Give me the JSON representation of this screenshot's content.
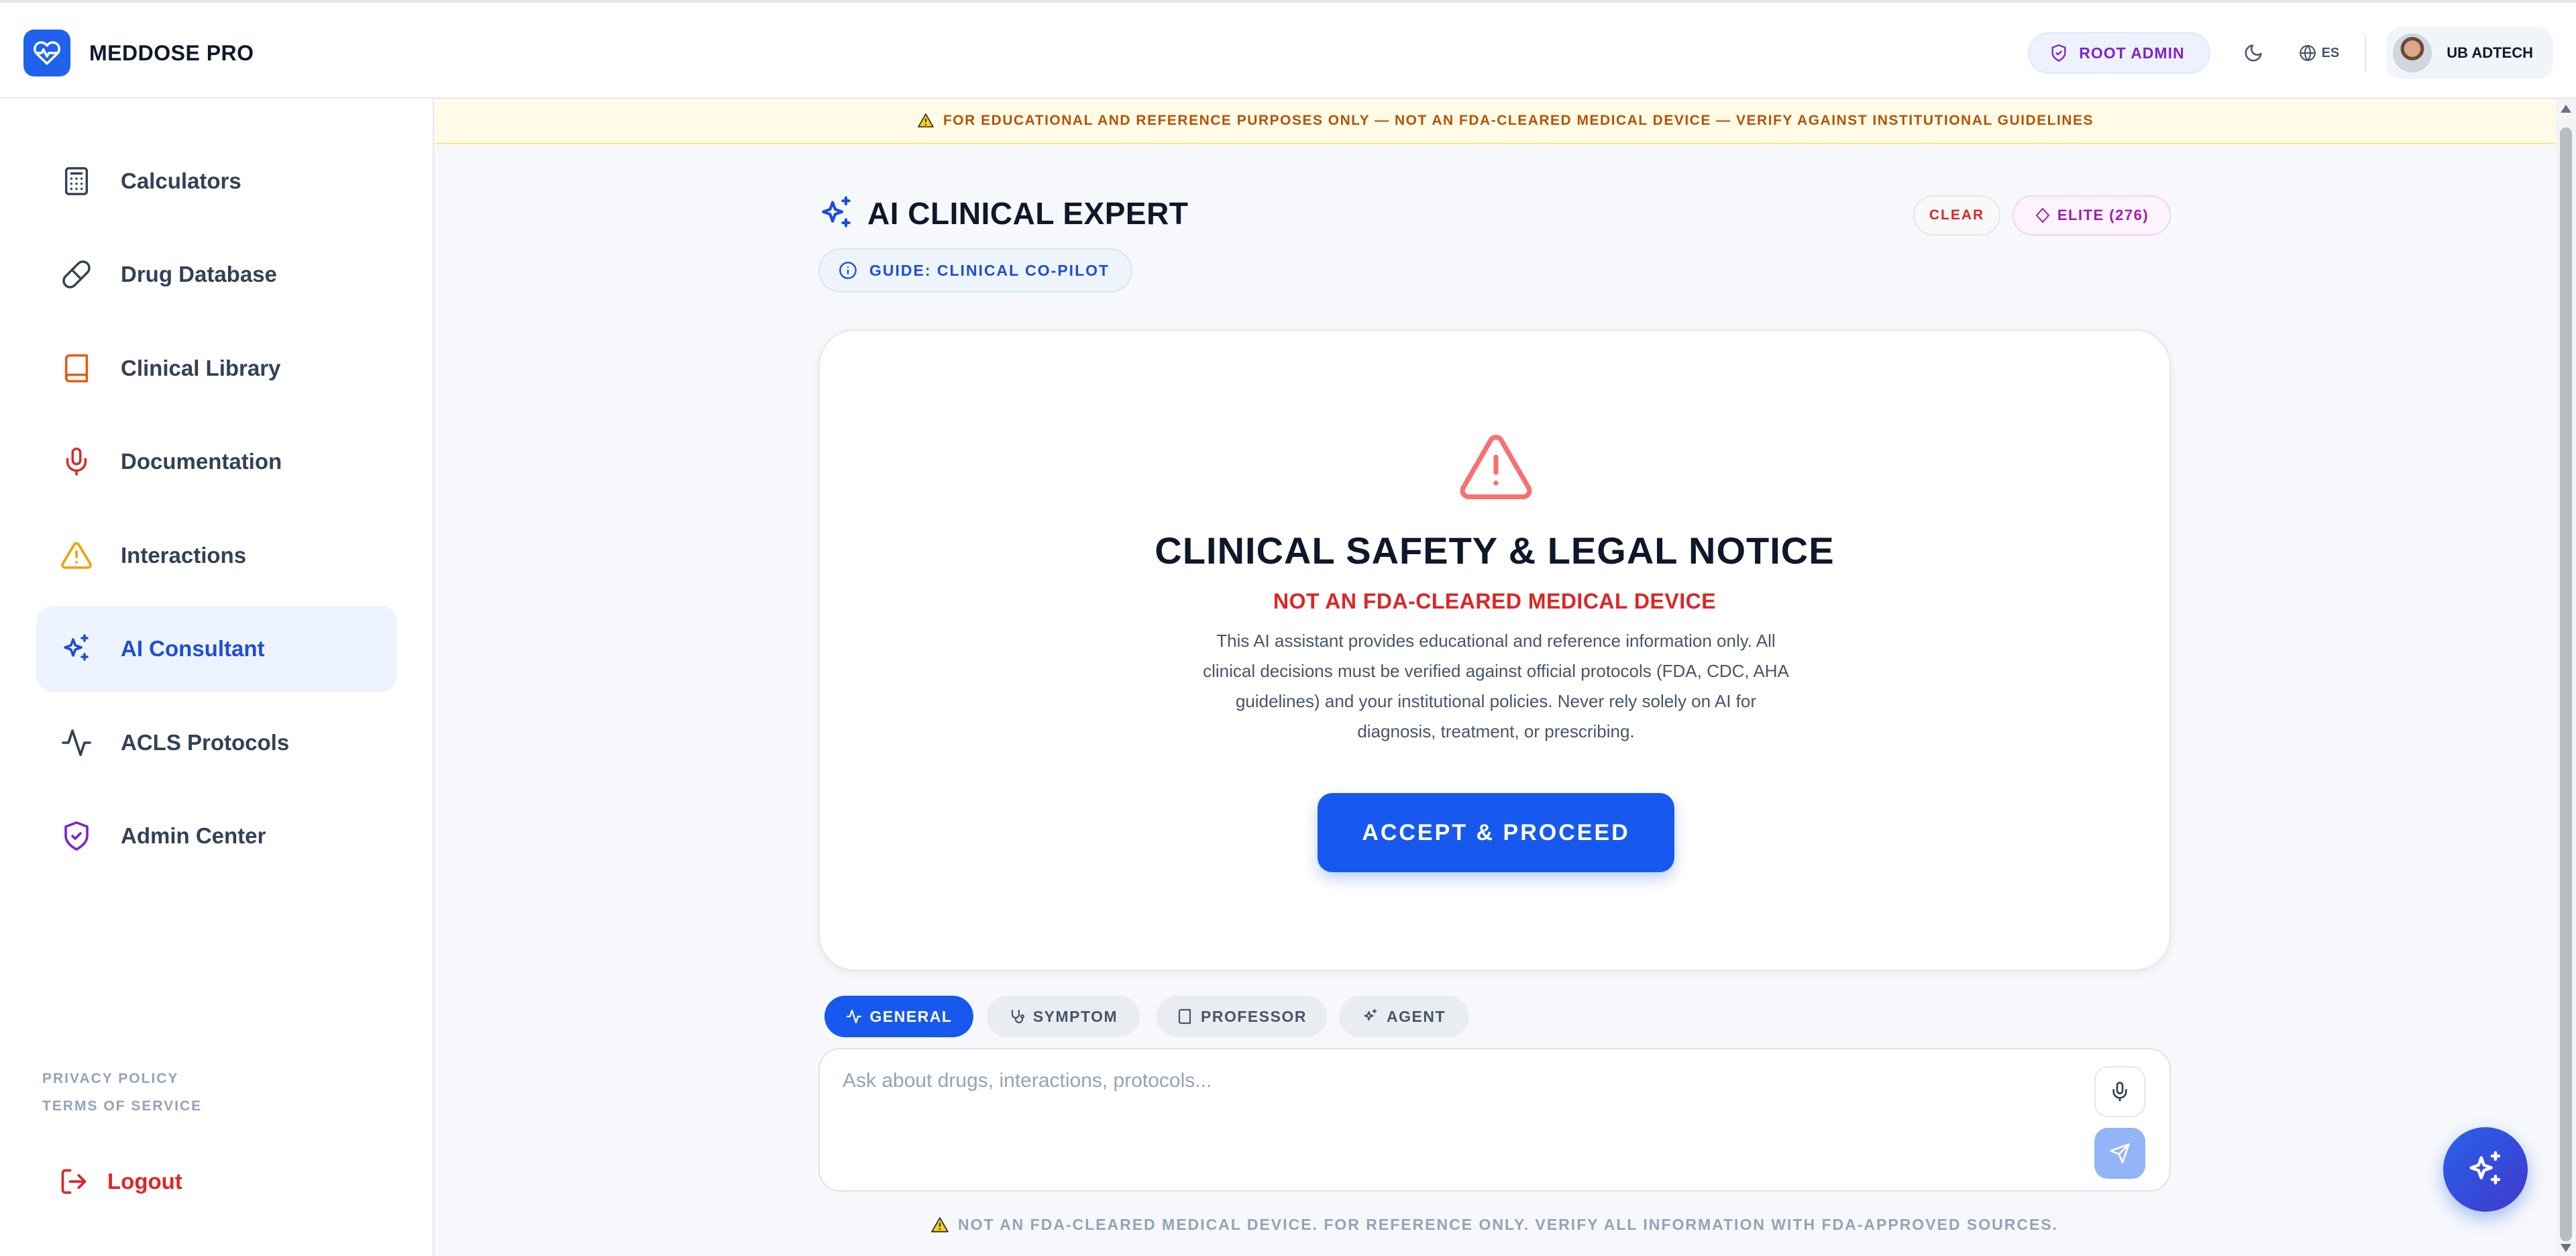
{
  "app": {
    "name": "MEDDOSE PRO",
    "role_badge": "ROOT ADMIN",
    "language": "ES",
    "user_name": "UB ADTECH"
  },
  "sidebar": {
    "items": [
      {
        "label": "Calculators",
        "icon": "calculator-icon"
      },
      {
        "label": "Drug Database",
        "icon": "pill-icon"
      },
      {
        "label": "Clinical Library",
        "icon": "book-icon"
      },
      {
        "label": "Documentation",
        "icon": "microphone-icon"
      },
      {
        "label": "Interactions",
        "icon": "warning-icon"
      },
      {
        "label": "AI Consultant",
        "icon": "sparkles-icon",
        "active": true
      },
      {
        "label": "ACLS Protocols",
        "icon": "pulse-icon"
      },
      {
        "label": "Admin Center",
        "icon": "shield-check-icon"
      }
    ],
    "privacy": "PRIVACY POLICY",
    "terms": "TERMS OF SERVICE",
    "logout": "Logout"
  },
  "banner": {
    "text": "FOR EDUCATIONAL AND REFERENCE PURPOSES ONLY — NOT AN FDA-CLEARED MEDICAL DEVICE — VERIFY AGAINST INSTITUTIONAL GUIDELINES"
  },
  "main": {
    "title": "AI CLINICAL EXPERT",
    "guide": "GUIDE: CLINICAL CO-PILOT",
    "clear": "CLEAR",
    "elite": "ELITE (276)"
  },
  "notice": {
    "title": "CLINICAL SAFETY & LEGAL NOTICE",
    "subtitle": "NOT AN FDA-CLEARED MEDICAL DEVICE",
    "body": "This AI assistant provides educational and reference information only. All clinical decisions must be verified against official protocols (FDA, CDC, AHA guidelines) and your institutional policies. Never rely solely on AI for diagnosis, treatment, or prescribing.",
    "accept": "ACCEPT & PROCEED"
  },
  "modes": [
    {
      "label": "GENERAL",
      "icon": "pulse-icon",
      "active": true
    },
    {
      "label": "SYMPTOM",
      "icon": "stethoscope-icon"
    },
    {
      "label": "PROFESSOR",
      "icon": "book-icon"
    },
    {
      "label": "AGENT",
      "icon": "sparkles-icon"
    }
  ],
  "composer": {
    "placeholder": "Ask about drugs, interactions, protocols...",
    "value": ""
  },
  "footer": {
    "text": "NOT AN FDA-CLEARED MEDICAL DEVICE. FOR REFERENCE ONLY. VERIFY ALL INFORMATION WITH FDA-APPROVED SOURCES."
  },
  "colors": {
    "primary": "#1759ef",
    "danger": "#dc2626",
    "warning": "#b45309",
    "purple": "#7e22ce"
  }
}
